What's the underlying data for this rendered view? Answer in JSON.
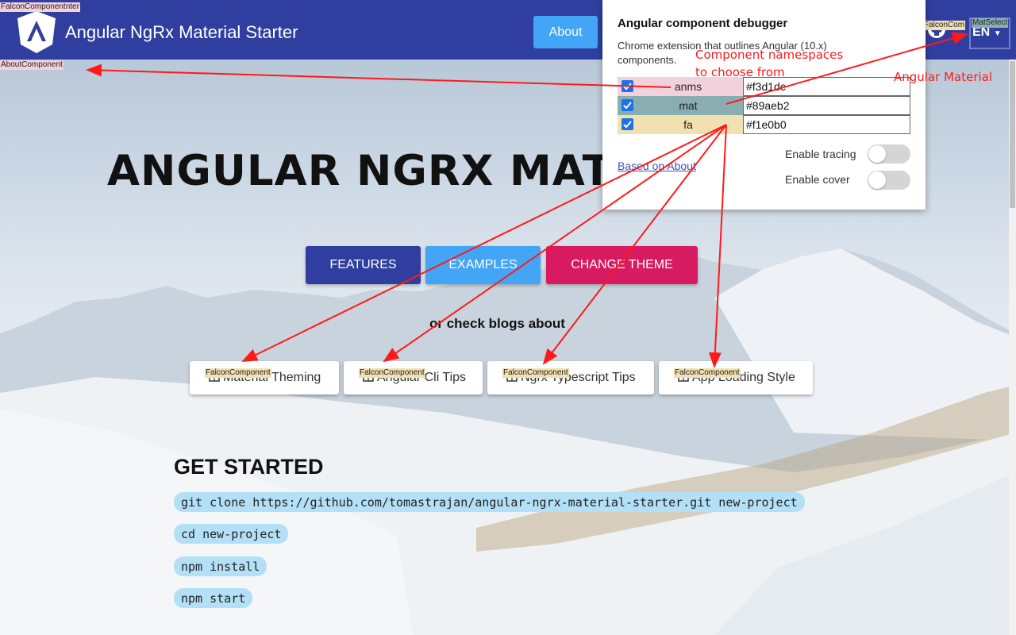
{
  "toolbar": {
    "app_title": "Angular NgRx Material Starter",
    "about_label": "About",
    "language_value": "EN",
    "logo_icon": "angular-logo-icon",
    "github_icon": "github-icon",
    "color": "#303f9f"
  },
  "component_tags": {
    "falcon_component_toolbar": "FalconComponentnter",
    "falcon_component_header_right": "FalconCom",
    "mat_select": "MatSelect",
    "about_component": "AboutComponent",
    "falcon_component": "FalconComponent"
  },
  "hero": {
    "title": "ANGULAR NGRX MATE",
    "buttons": {
      "features": "FEATURES",
      "examples": "EXAMPLES",
      "change_theme": "CHANGE THEME"
    },
    "blogs_text": "or check blogs about",
    "blog_links": [
      {
        "label": "Material Theming"
      },
      {
        "label": "Angular Cli Tips"
      },
      {
        "label": "Ngrx Typescript Tips"
      },
      {
        "label": "App Loading Style"
      }
    ]
  },
  "get_started": {
    "title": "GET STARTED",
    "commands": [
      "git clone https://github.com/tomastrajan/angular-ngrx-material-starter.git new-project",
      "cd new-project",
      "npm install",
      "npm start"
    ]
  },
  "debugger": {
    "title": "Angular component debugger",
    "description": "Chrome extension that outlines Angular (10.x) components.",
    "namespaces": [
      {
        "name": "anms",
        "color": "#f3d1dc",
        "checked": true
      },
      {
        "name": "mat",
        "color": "#89aeb2",
        "checked": true
      },
      {
        "name": "fa",
        "color": "#f1e0b0",
        "checked": true
      }
    ],
    "link_label": "Based on About",
    "enable_tracing_label": "Enable tracing",
    "enable_cover_label": "Enable cover",
    "enable_tracing": false,
    "enable_cover": false
  },
  "annotations": {
    "namespaces_line1": "Component namespaces",
    "namespaces_line2": "to choose from",
    "angular_material": "Angular Material",
    "color": "#ff1a1a"
  }
}
